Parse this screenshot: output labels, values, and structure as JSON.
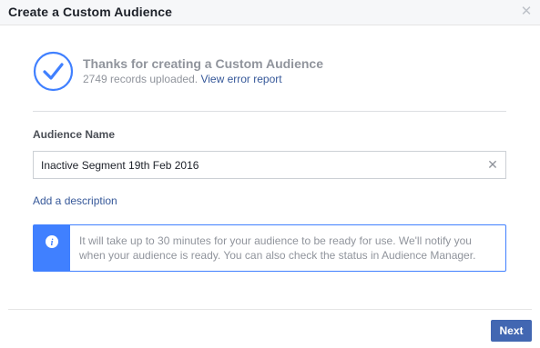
{
  "dialog": {
    "title": "Create a Custom Audience",
    "close_icon": "close-icon"
  },
  "success": {
    "icon": "check-circle-icon",
    "title": "Thanks for creating a Custom Audience",
    "records_text": "2749 records uploaded.",
    "error_link": "View error report"
  },
  "audience_name": {
    "label": "Audience Name",
    "value": "Inactive Segment 19th Feb 2016",
    "clear_icon": "clear-icon"
  },
  "add_description": "Add a description",
  "info": {
    "icon": "info-icon",
    "text": "It will take up to 30 minutes for your audience to be ready for use. We'll notify you when your audience is ready. You can also check the status in Audience Manager."
  },
  "footer": {
    "next_label": "Next"
  },
  "colors": {
    "header_bg": "#f6f7f9",
    "link": "#365899",
    "accent_blue": "#4080ff",
    "primary_button": "#4267b2",
    "muted_text": "#90949c"
  }
}
